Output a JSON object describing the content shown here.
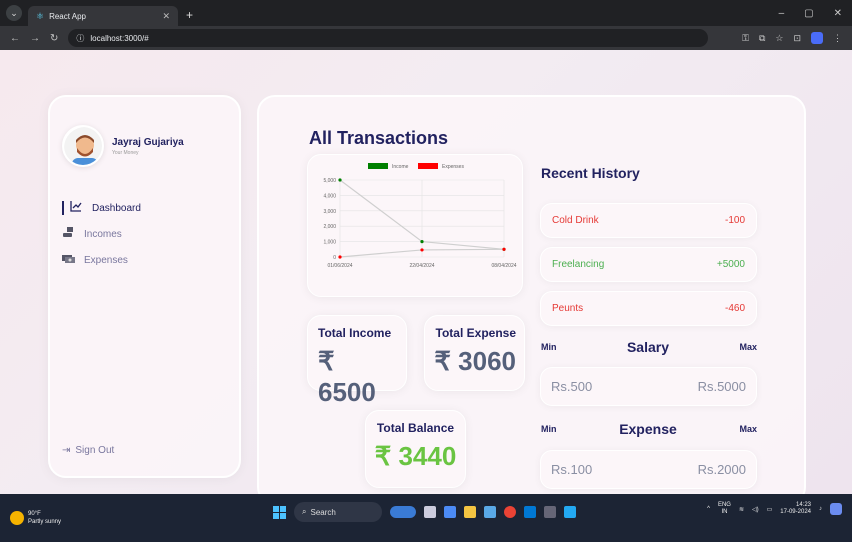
{
  "browser": {
    "tab_title": "React App",
    "url": "localhost:3000/#"
  },
  "user": {
    "name": "Jayraj Gujariya",
    "subtitle": "Your Money"
  },
  "menu": [
    {
      "label": "Dashboard",
      "icon": "chart-line-icon"
    },
    {
      "label": "Incomes",
      "icon": "money-hand-icon"
    },
    {
      "label": "Expenses",
      "icon": "money-bills-icon"
    }
  ],
  "signout_label": "Sign Out",
  "main": {
    "title": "All Transactions",
    "total_income_label": "Total Income",
    "total_income_value": "₹ 6500",
    "total_expense_label": "Total Expense",
    "total_expense_value": "₹ 3060",
    "total_balance_label": "Total Balance",
    "total_balance_value": "₹ 3440",
    "recent_history_title": "Recent History",
    "history": [
      {
        "title": "Cold Drink",
        "amount": "-100",
        "type": "neg"
      },
      {
        "title": "Freelancing",
        "amount": "+5000",
        "type": "pos"
      },
      {
        "title": "Peunts",
        "amount": "-460",
        "type": "neg"
      }
    ],
    "salary": {
      "min_label": "Min",
      "title": "Salary",
      "max_label": "Max",
      "min": "Rs.500",
      "max": "Rs.5000"
    },
    "expense": {
      "min_label": "Min",
      "title": "Expense",
      "max_label": "Max",
      "min": "Rs.100",
      "max": "Rs.2000"
    }
  },
  "chart_data": {
    "type": "line",
    "categories": [
      "01/06/2024",
      "22/04/2024",
      "08/04/2024"
    ],
    "series": [
      {
        "name": "Income",
        "values": [
          5000,
          1000,
          500
        ],
        "color": "#008000"
      },
      {
        "name": "Expenses",
        "values": [
          0,
          460,
          500
        ],
        "color": "#ff0000"
      }
    ],
    "ylim": [
      0,
      5000
    ],
    "yticks": [
      "5,000",
      "4,000",
      "3,000",
      "2,000",
      "1,000",
      "0"
    ],
    "legend": "top",
    "grid": true
  },
  "taskbar": {
    "temp": "90°F",
    "weather": "Partly sunny",
    "search": "Search",
    "lang": "ENG",
    "region": "IN",
    "time": "14:23",
    "date": "17-09-2024"
  },
  "colors": {
    "primary": "#222260",
    "negative": "#e53935",
    "positive": "#4caf50",
    "balance": "#42ad00"
  }
}
